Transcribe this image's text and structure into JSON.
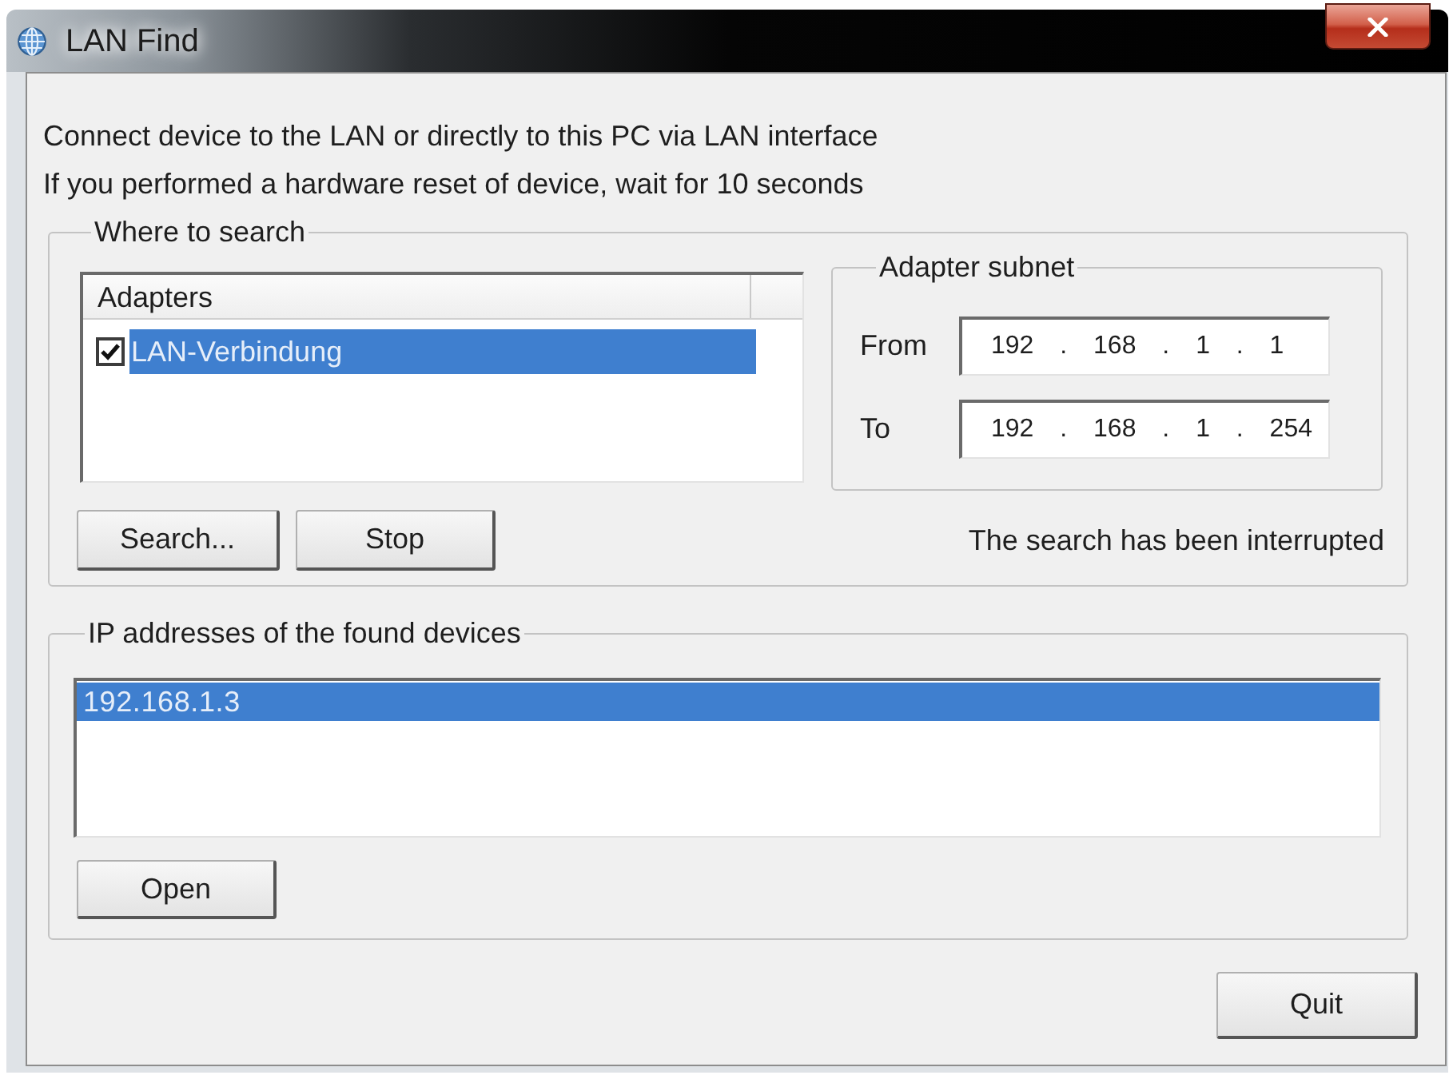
{
  "window": {
    "title": "LAN Find"
  },
  "instructions": [
    "Connect device to the LAN or directly to this PC via LAN interface",
    "If you performed a hardware reset of device, wait for 10 seconds"
  ],
  "where_to_search": {
    "title": "Where to search",
    "adapters": {
      "columns": [
        "Adapters"
      ],
      "rows": [
        {
          "name": "LAN-Verbindung",
          "checked": true,
          "selected": true
        }
      ]
    },
    "subnet": {
      "title": "Adapter subnet",
      "fields": [
        {
          "label": "From",
          "value": "192 . 168 . 1 . 1"
        },
        {
          "label": "To",
          "value": "192 . 168 . 1 . 254"
        }
      ]
    },
    "buttons": [
      "Search...",
      "Stop"
    ],
    "status": "The search has been interrupted"
  },
  "found_devices": {
    "title": "IP addresses of the found devices",
    "rows": [
      {
        "address": "192.168.1.3",
        "selected": true
      }
    ],
    "buttons": [
      "Open"
    ]
  },
  "buttons": [
    "Quit"
  ]
}
